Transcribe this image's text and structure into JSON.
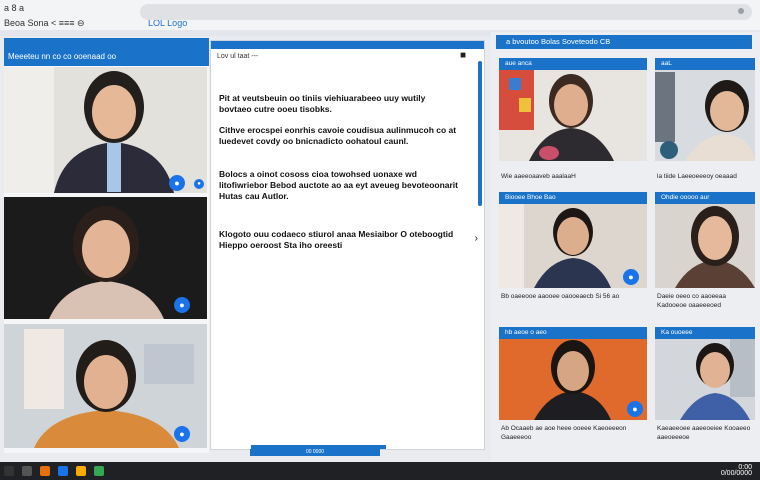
{
  "browser": {
    "nav_text_1": "a  8 a",
    "nav_text_2": "Beoa  Sona  <  ≡≡≡  ⊖",
    "tab_label": "LOL Logo"
  },
  "left_panel": {
    "title": "Meeeteu nn co co ooenaad oo"
  },
  "document": {
    "title": "Lov ul taat   ---",
    "paragraphs": [
      "Pit at veutsbeuin oo tiniis viehiuarabeeo uuy wutily bovtaeo cutre ooeu tisobks.",
      "Cithve erocspei eonrhis cavoie coudisua aulinmucoh co at Iuedevet covdy oo bnicnadicto oohatoul caunl.",
      "Bolocs a oinot cososs cioa towohsed uonaxe wd litofiwriebor Bebod auctote ao aa eyt aveueg bevoteoonarit Hutas cau Autlor.",
      "Klogoto ouu codaeco stiurol anaa Mesiaibor O oteboogtid Hieppo oeroost Sta iho oreesti"
    ],
    "chevron": "›"
  },
  "gallery": {
    "title": "a bvoutoo  Bolas  Soveteodo CB",
    "tiles": [
      {
        "cap": "aue anca"
      },
      {
        "cap": "aaL"
      },
      {
        "cap": "Biooee  Bhoe Bao"
      },
      {
        "cap": "Ohdie ooooo aur"
      },
      {
        "cap": "hb aeoe  o aeo"
      },
      {
        "cap": "Ka ouoeee"
      }
    ],
    "captions": {
      "row1_left": "Wie aaeeoaaveb aaalaaH",
      "row1_right": "la tiide Laeeoeeeoy oeaaad",
      "row2_left": "Bb  oaeeooe aaooee oaooeaecb  Si 56 ao",
      "row2_right": "Daeie oeeo co aaoeeaa Kadooeoe oaaeeeoed",
      "row3_left": "Ab  Ocaaeb ae aoe  heee ooeee  Kaeoeeeon Gaaeeeoo",
      "row3_right": "Kaeaeeoee aaeeoeiee  Kooaeeo aaeoeeeoe"
    }
  },
  "taskbar": {
    "clock_time": "0:00",
    "clock_date": "0/00/0000",
    "lower_label": "00  0000"
  },
  "colors": {
    "accent": "#1a73c8",
    "taskbar": "#202124"
  }
}
